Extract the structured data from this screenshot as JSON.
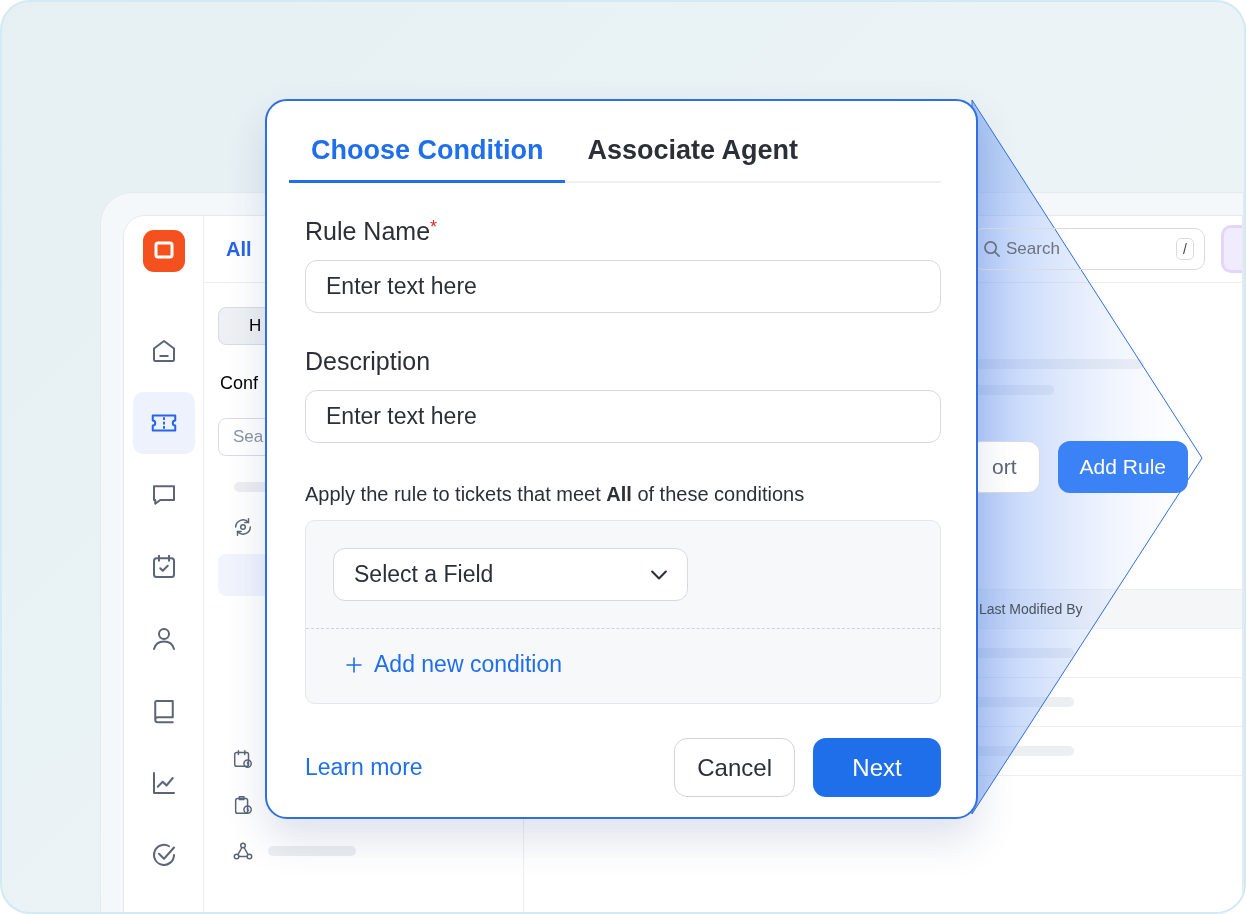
{
  "app": {
    "nav_items": [
      {
        "selected": false
      },
      {
        "selected": true
      },
      {
        "selected": false
      },
      {
        "selected": false
      },
      {
        "selected": false
      },
      {
        "selected": false
      },
      {
        "selected": false
      },
      {
        "selected": false
      }
    ],
    "header_title": "All",
    "panel": {
      "button": "H",
      "heading": "Conf",
      "search_placeholder": "Sea"
    },
    "search": {
      "placeholder": "Search",
      "shortcut": "/"
    },
    "buttons": [
      {
        "label": "ort",
        "kind": "secondary"
      },
      {
        "label": "Add Rule",
        "kind": "primary"
      }
    ],
    "table": {
      "columns": [
        "Last Modified By"
      ]
    }
  },
  "modal": {
    "tabs": [
      {
        "label": "Choose Condition",
        "selected": true
      },
      {
        "label": "Associate Agent",
        "selected": false
      }
    ],
    "fields": [
      {
        "label": "Rule Name",
        "required_mark": "*",
        "placeholder": "Enter text here"
      },
      {
        "label": "Description",
        "placeholder": "Enter text here"
      }
    ],
    "conditions_text": "Apply the rule to tickets that meet **All** of these conditions",
    "field_select": "Select a Field",
    "add_condition": "Add new condition",
    "learn_more": "Learn more",
    "buttons": [
      {
        "label": "Cancel",
        "kind": "secondary"
      },
      {
        "label": "Next",
        "kind": "primary"
      }
    ]
  }
}
